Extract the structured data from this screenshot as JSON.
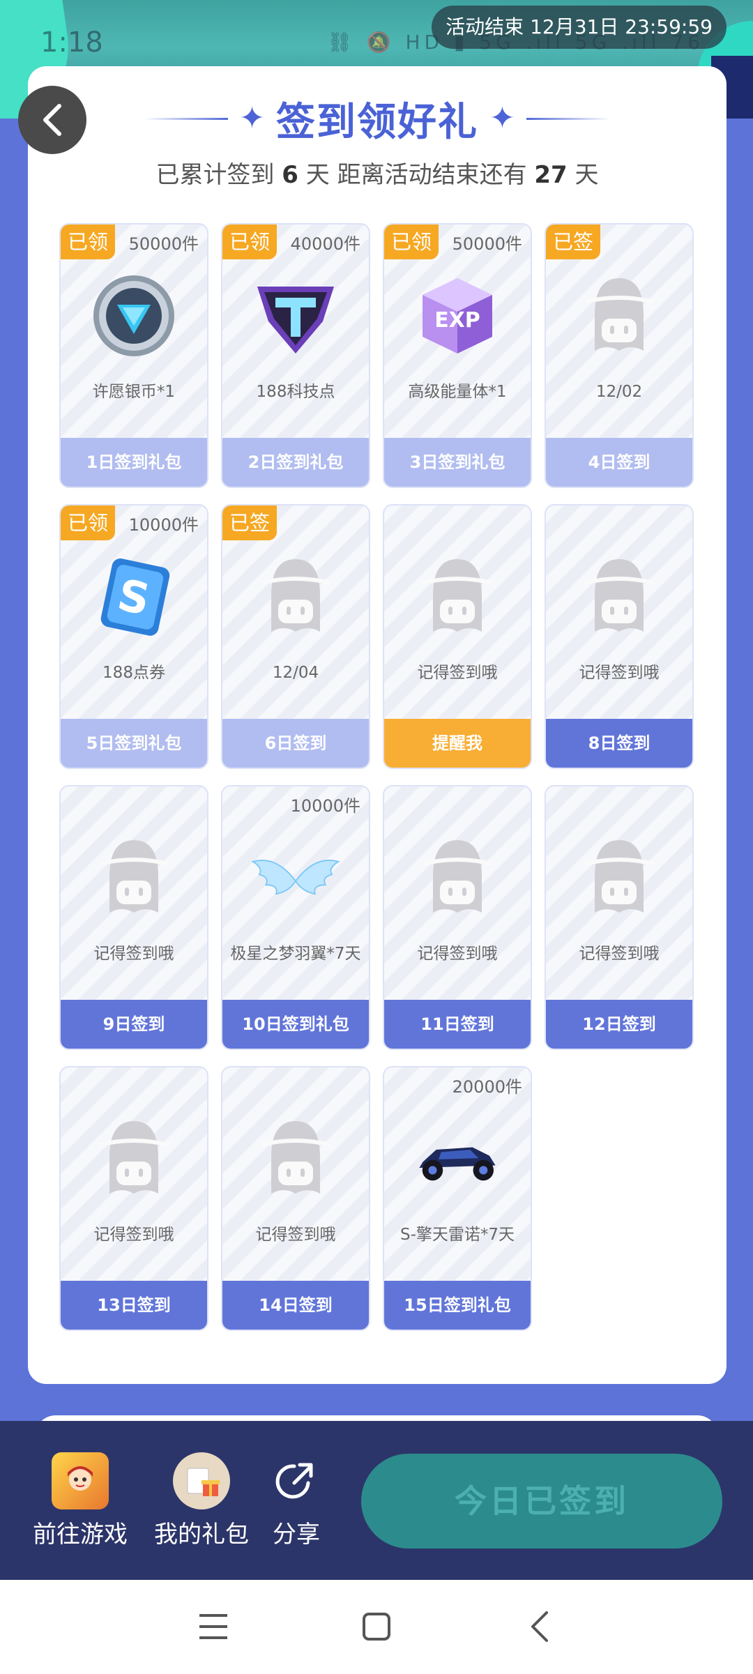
{
  "status_bar": {
    "time": "1:18",
    "icons": "⛓ 🔕 HD ▮ 5G .ıll 5G .ıll 76",
    "activity_end": "活动结束 12月31日 23:59:59"
  },
  "header": {
    "title": "签到领好礼",
    "subtitle_prefix": "已累计签到",
    "signed_days": "6",
    "subtitle_mid": "天  距离活动结束还有",
    "remaining_days": "27",
    "subtitle_suffix": "天"
  },
  "colors": {
    "accent": "#5269d6",
    "badge": "#f6a823",
    "remind": "#f8ae34",
    "done_button": "#b1bdf0",
    "future_button": "#6175d9",
    "bottom_bar": "#2c3569"
  },
  "days": [
    {
      "badge": "已领",
      "qty": "50000件",
      "icon": "silver-coin-icon",
      "name": "许愿银币*1",
      "button": "1日签到礼包",
      "state": "done"
    },
    {
      "badge": "已领",
      "qty": "40000件",
      "icon": "tech-point-icon",
      "name": "188科技点",
      "button": "2日签到礼包",
      "state": "done"
    },
    {
      "badge": "已领",
      "qty": "50000件",
      "icon": "exp-cube-icon",
      "name": "高级能量体*1",
      "button": "3日签到礼包",
      "state": "done"
    },
    {
      "badge": "已签",
      "qty": "",
      "icon": "mascot-placeholder-icon",
      "name": "12/02",
      "button": "4日签到",
      "state": "done"
    },
    {
      "badge": "已领",
      "qty": "10000件",
      "icon": "point-coupon-icon",
      "name": "188点券",
      "button": "5日签到礼包",
      "state": "done"
    },
    {
      "badge": "已签",
      "qty": "",
      "icon": "mascot-placeholder-icon",
      "name": "12/04",
      "button": "6日签到",
      "state": "done"
    },
    {
      "badge": "",
      "qty": "",
      "icon": "mascot-placeholder-icon",
      "name": "记得签到哦",
      "button": "提醒我",
      "state": "remind"
    },
    {
      "badge": "",
      "qty": "",
      "icon": "mascot-placeholder-icon",
      "name": "记得签到哦",
      "button": "8日签到",
      "state": "future"
    },
    {
      "badge": "",
      "qty": "",
      "icon": "mascot-placeholder-icon",
      "name": "记得签到哦",
      "button": "9日签到",
      "state": "future"
    },
    {
      "badge": "",
      "qty": "10000件",
      "icon": "angel-wings-icon",
      "name": "极星之梦羽翼*7天",
      "button": "10日签到礼包",
      "state": "future"
    },
    {
      "badge": "",
      "qty": "",
      "icon": "mascot-placeholder-icon",
      "name": "记得签到哦",
      "button": "11日签到",
      "state": "future"
    },
    {
      "badge": "",
      "qty": "",
      "icon": "mascot-placeholder-icon",
      "name": "记得签到哦",
      "button": "12日签到",
      "state": "future"
    },
    {
      "badge": "",
      "qty": "",
      "icon": "mascot-placeholder-icon",
      "name": "记得签到哦",
      "button": "13日签到",
      "state": "future"
    },
    {
      "badge": "",
      "qty": "",
      "icon": "mascot-placeholder-icon",
      "name": "记得签到哦",
      "button": "14日签到",
      "state": "future"
    },
    {
      "badge": "",
      "qty": "20000件",
      "icon": "race-car-icon",
      "name": "S-擎天雷诺*7天",
      "button": "15日签到礼包",
      "state": "future"
    }
  ],
  "bottom_bar": {
    "goto_game": "前往游戏",
    "my_gifts": "我的礼包",
    "share": "分享",
    "signed_today": "今日已签到"
  }
}
